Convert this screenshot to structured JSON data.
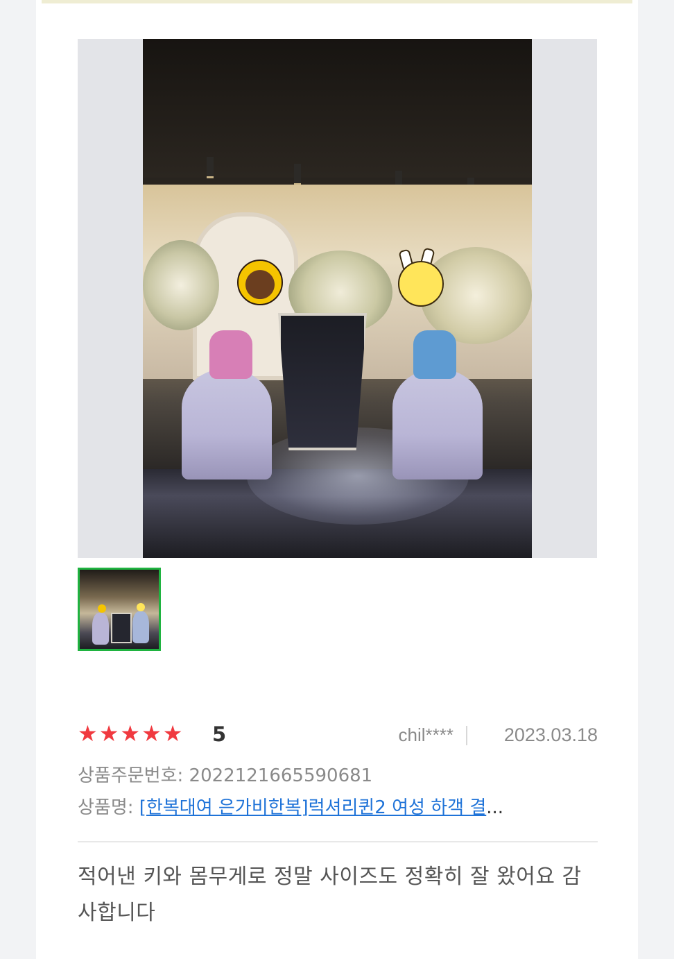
{
  "review": {
    "rating_stars": 5,
    "score_label": "5",
    "user": "chil****",
    "date": "2023.03.18",
    "order_label": "상품주문번호:",
    "order_number": "2022121665590681",
    "product_label": "상품명:",
    "product_name": "[한복대여 은가비한복]럭셔리퀸2 여성 하객 결",
    "product_ellipsis": "...",
    "text": "적어낸 키와 몸무게로 정말 사이즈도 정확히 잘 왔어요 감사합니다"
  },
  "colors": {
    "star": "#f0393f",
    "thumb_border": "#1fb340",
    "link": "#1f73d8"
  },
  "icons": {
    "star": "star-icon"
  }
}
